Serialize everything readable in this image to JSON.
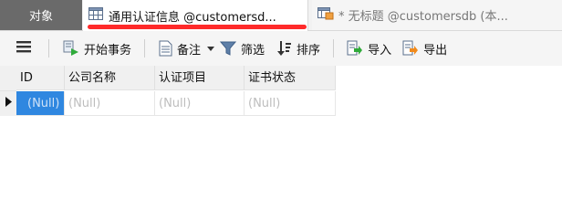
{
  "tabs": {
    "objects": "对象",
    "table_tab": "通用认证信息 @customersd...",
    "query_tab": "* 无标题 @customersdb (本..."
  },
  "toolbar": {
    "begin_transaction": "开始事务",
    "notes": "备注",
    "filter": "筛选",
    "sort": "排序",
    "import": "导入",
    "export": "导出"
  },
  "grid": {
    "columns": [
      "ID",
      "公司名称",
      "认证项目",
      "证书状态"
    ],
    "rows": [
      [
        "(Null)",
        "(Null)",
        "(Null)",
        "(Null)"
      ]
    ]
  },
  "colors": {
    "active_cell": "#2f87e0",
    "highlight_underline": "#ff2a2a",
    "objects_tab": "#6a6a6a"
  }
}
